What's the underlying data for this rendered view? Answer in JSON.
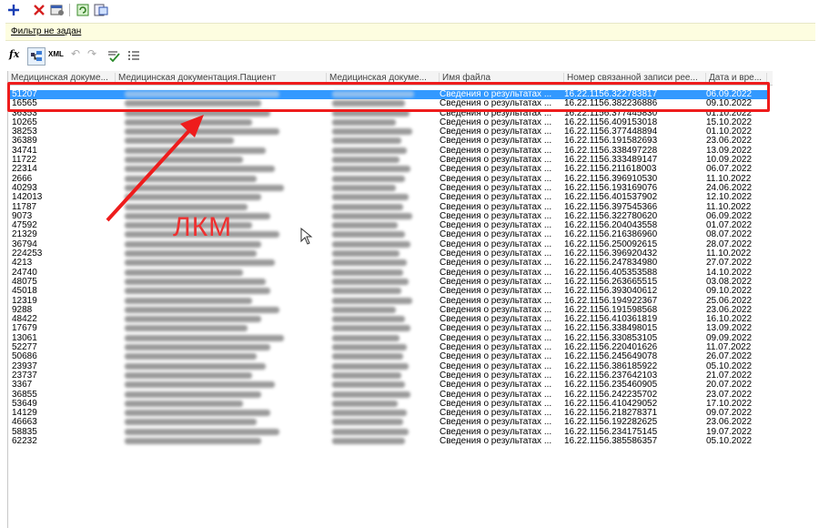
{
  "toolbar": {
    "add_icon": "plus-icon",
    "delete_icon": "cross-icon",
    "properties_icon": "properties-icon",
    "refresh_icon": "refresh-icon",
    "export_icon": "export-icon"
  },
  "filter": {
    "text": "Фильтр не задан"
  },
  "toolbar2": {
    "fx_label": "fx",
    "xml_label": "XML"
  },
  "columns": [
    "Медицинская докуме...",
    "Медицинская документация.Пациент",
    "Медицинская докуме...",
    "Имя файла",
    "Номер связанной записи рее...",
    "Дата и вре..."
  ],
  "rows": [
    {
      "id": "51207",
      "file": "Сведения о результатах ...",
      "num": "16.22.1156.322783817",
      "date": "06.09.2022"
    },
    {
      "id": "16565",
      "file": "Сведения о результатах ...",
      "num": "16.22.1156.382236886",
      "date": "09.10.2022"
    },
    {
      "id": "36353",
      "file": "Сведения о результатах ...",
      "num": "16.22.1156.377445830",
      "date": "01.10.2022"
    },
    {
      "id": "10265",
      "file": "Сведения о результатах ...",
      "num": "16.22.1156.409153018",
      "date": "15.10.2022"
    },
    {
      "id": "38253",
      "file": "Сведения о результатах ...",
      "num": "16.22.1156.377448894",
      "date": "01.10.2022"
    },
    {
      "id": "36389",
      "file": "Сведения о результатах ...",
      "num": "16.22.1156.191582693",
      "date": "23.06.2022"
    },
    {
      "id": "34741",
      "file": "Сведения о результатах ...",
      "num": "16.22.1156.338497228",
      "date": "13.09.2022"
    },
    {
      "id": "11722",
      "file": "Сведения о результатах ...",
      "num": "16.22.1156.333489147",
      "date": "10.09.2022"
    },
    {
      "id": "22314",
      "file": "Сведения о результатах ...",
      "num": "16.22.1156.211618003",
      "date": "06.07.2022"
    },
    {
      "id": "2666",
      "file": "Сведения о результатах ...",
      "num": "16.22.1156.396910530",
      "date": "11.10.2022"
    },
    {
      "id": "40293",
      "file": "Сведения о результатах ...",
      "num": "16.22.1156.193169076",
      "date": "24.06.2022"
    },
    {
      "id": "142013",
      "file": "Сведения о результатах ...",
      "num": "16.22.1156.401537902",
      "date": "12.10.2022"
    },
    {
      "id": "11787",
      "file": "Сведения о результатах ...",
      "num": "16.22.1156.397545366",
      "date": "11.10.2022"
    },
    {
      "id": "9073",
      "file": "Сведения о результатах ...",
      "num": "16.22.1156.322780620",
      "date": "06.09.2022"
    },
    {
      "id": "47592",
      "file": "Сведения о результатах ...",
      "num": "16.22.1156.204043558",
      "date": "01.07.2022"
    },
    {
      "id": "21329",
      "file": "Сведения о результатах ...",
      "num": "16.22.1156.216386960",
      "date": "08.07.2022"
    },
    {
      "id": "36794",
      "file": "Сведения о результатах ...",
      "num": "16.22.1156.250092615",
      "date": "28.07.2022"
    },
    {
      "id": "224253",
      "file": "Сведения о результатах ...",
      "num": "16.22.1156.396920432",
      "date": "11.10.2022"
    },
    {
      "id": "4213",
      "file": "Сведения о результатах ...",
      "num": "16.22.1156.247834980",
      "date": "27.07.2022"
    },
    {
      "id": "24740",
      "file": "Сведения о результатах ...",
      "num": "16.22.1156.405353588",
      "date": "14.10.2022"
    },
    {
      "id": "48075",
      "file": "Сведения о результатах ...",
      "num": "16.22.1156.263665515",
      "date": "03.08.2022"
    },
    {
      "id": "45018",
      "file": "Сведения о результатах ...",
      "num": "16.22.1156.393040612",
      "date": "09.10.2022"
    },
    {
      "id": "12319",
      "file": "Сведения о результатах ...",
      "num": "16.22.1156.194922367",
      "date": "25.06.2022"
    },
    {
      "id": "9288",
      "file": "Сведения о результатах ...",
      "num": "16.22.1156.191598568",
      "date": "23.06.2022"
    },
    {
      "id": "48422",
      "file": "Сведения о результатах ...",
      "num": "16.22.1156.410361819",
      "date": "16.10.2022"
    },
    {
      "id": "17679",
      "file": "Сведения о результатах ...",
      "num": "16.22.1156.338498015",
      "date": "13.09.2022"
    },
    {
      "id": "13061",
      "file": "Сведения о результатах ...",
      "num": "16.22.1156.330853105",
      "date": "09.09.2022"
    },
    {
      "id": "52277",
      "file": "Сведения о результатах ...",
      "num": "16.22.1156.220401626",
      "date": "11.07.2022"
    },
    {
      "id": "50686",
      "file": "Сведения о результатах ...",
      "num": "16.22.1156.245649078",
      "date": "26.07.2022"
    },
    {
      "id": "23937",
      "file": "Сведения о результатах ...",
      "num": "16.22.1156.386185922",
      "date": "05.10.2022"
    },
    {
      "id": "23737",
      "file": "Сведения о результатах ...",
      "num": "16.22.1156.237642103",
      "date": "21.07.2022"
    },
    {
      "id": "3367",
      "file": "Сведения о результатах ...",
      "num": "16.22.1156.235460905",
      "date": "20.07.2022"
    },
    {
      "id": "36855",
      "file": "Сведения о результатах ...",
      "num": "16.22.1156.242235702",
      "date": "23.07.2022"
    },
    {
      "id": "53649",
      "file": "Сведения о результатах ...",
      "num": "16.22.1156.410429052",
      "date": "17.10.2022"
    },
    {
      "id": "14129",
      "file": "Сведения о результатах ...",
      "num": "16.22.1156.218278371",
      "date": "09.07.2022"
    },
    {
      "id": "46663",
      "file": "Сведения о результатах ...",
      "num": "16.22.1156.192282625",
      "date": "23.06.2022"
    },
    {
      "id": "58835",
      "file": "Сведения о результатах ...",
      "num": "16.22.1156.234175145",
      "date": "19.07.2022"
    },
    {
      "id": "62232",
      "file": "Сведения о результатах ...",
      "num": "16.22.1156.385586357",
      "date": "05.10.2022"
    }
  ],
  "annotation": {
    "label": "ЛКМ"
  }
}
